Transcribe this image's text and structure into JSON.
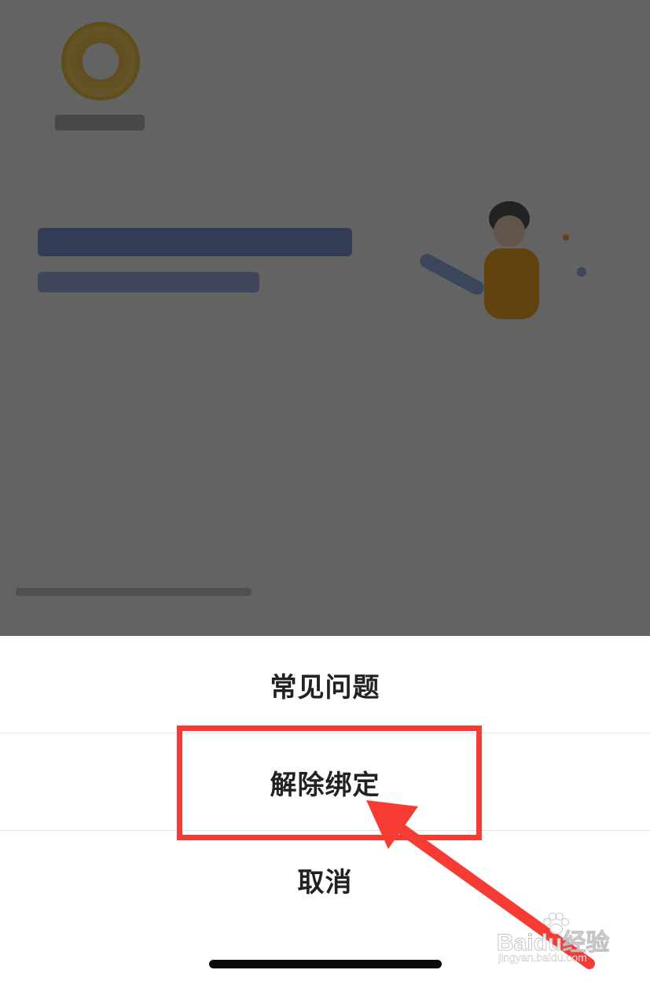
{
  "action_sheet": {
    "items": [
      {
        "label": "常见问题"
      },
      {
        "label": "解除绑定"
      },
      {
        "label": "取消"
      }
    ]
  },
  "annotation": {
    "color": "#f53b34",
    "highlighted_item": "解除绑定"
  },
  "watermark": {
    "brand": "Baidu经验",
    "url": "jingyan.baidu.com"
  },
  "colors": {
    "overlay": "rgba(0,0,0,0.6)",
    "sheet_background": "#ffffff",
    "item_text": "#222222",
    "divider": "#e3e3e3"
  }
}
